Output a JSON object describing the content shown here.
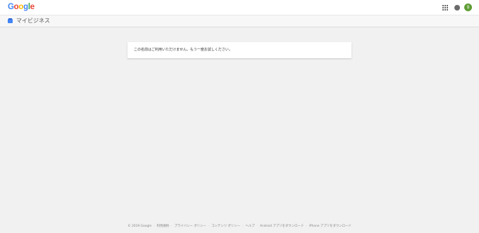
{
  "header": {
    "logo_letters": [
      {
        "char": "G",
        "color": "#4285F4"
      },
      {
        "char": "o",
        "color": "#EA4335"
      },
      {
        "char": "o",
        "color": "#FBBC05"
      },
      {
        "char": "g",
        "color": "#4285F4"
      },
      {
        "char": "l",
        "color": "#34A853"
      },
      {
        "char": "e",
        "color": "#EA4335"
      }
    ],
    "avatar_initial": "g",
    "avatar_color": "#5e9c34",
    "icons": [
      "apps-grid-icon",
      "notifications-icon"
    ]
  },
  "subheader": {
    "title": "マイビジネス",
    "icon": "google-my-business-icon",
    "icon_color": "#4285F4"
  },
  "message": {
    "text": "この名前はご利用いただけません。もう一度お試しください。"
  },
  "footer": {
    "copyright": "© 2019 Google",
    "links": [
      "利用規約",
      "プライバシー ポリシー",
      "コンテンツ ポリシー",
      "ヘルプ",
      "Android アプリをダウンロード",
      "iPhone アプリをダウンロード"
    ]
  }
}
